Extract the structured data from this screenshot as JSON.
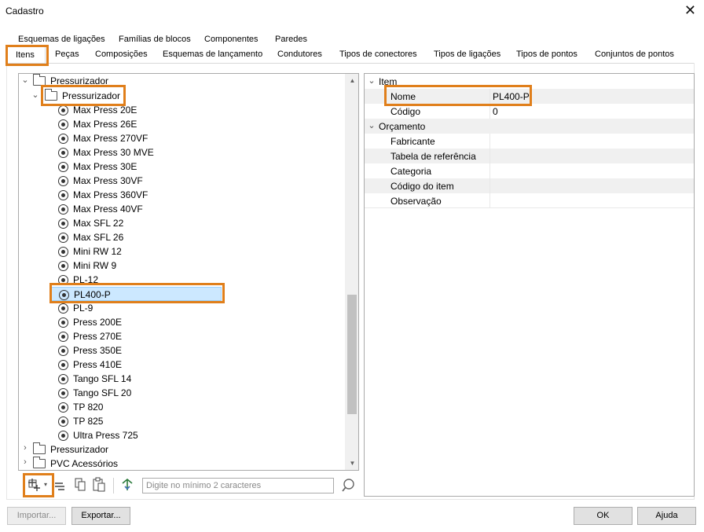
{
  "window": {
    "title": "Cadastro"
  },
  "tabs_row1": [
    "Esquemas de ligações",
    "Famílias de blocos",
    "Componentes",
    "Paredes"
  ],
  "tabs_row2": [
    "Itens",
    "Peças",
    "Composições",
    "Esquemas de lançamento",
    "Condutores",
    "Tipos de conectores",
    "Tipos de ligações",
    "Tipos de pontos",
    "Conjuntos de pontos"
  ],
  "tree": {
    "root_label": "Pressurizador",
    "sub_label": "Pressurizador",
    "items": [
      "Max Press 20E",
      "Max Press 26E",
      "Max Press 270VF",
      "Max Press 30 MVE",
      "Max Press 30E",
      "Max Press 30VF",
      "Max Press 360VF",
      "Max Press 40VF",
      "Max SFL 22",
      "Max SFL 26",
      "Mini RW 12",
      "Mini RW 9",
      "PL-12",
      "PL400-P",
      "PL-9",
      "Press 200E",
      "Press 270E",
      "Press 350E",
      "Press 410E",
      "Tango SFL 14",
      "Tango SFL 20",
      "TP 820",
      "TP 825",
      "Ultra Press 725"
    ],
    "selected": "PL400-P",
    "after": [
      "Pressurizador",
      "PVC Acessórios"
    ]
  },
  "search": {
    "placeholder": "Digite no mínimo 2 caracteres"
  },
  "props": {
    "item_section": "Item",
    "nome_label": "Nome",
    "nome_value": "PL400-P",
    "codigo_label": "Código",
    "codigo_value": "0",
    "orcamento_section": "Orçamento",
    "fabricante_label": "Fabricante",
    "tabela_label": "Tabela de referência",
    "categoria_label": "Categoria",
    "codigo_item_label": "Código do item",
    "observacao_label": "Observação"
  },
  "buttons": {
    "importar": "Importar...",
    "exportar": "Exportar...",
    "ok": "OK",
    "ajuda": "Ajuda"
  },
  "colors": {
    "highlight": "#e07f1b",
    "selection": "#cce8ff"
  }
}
